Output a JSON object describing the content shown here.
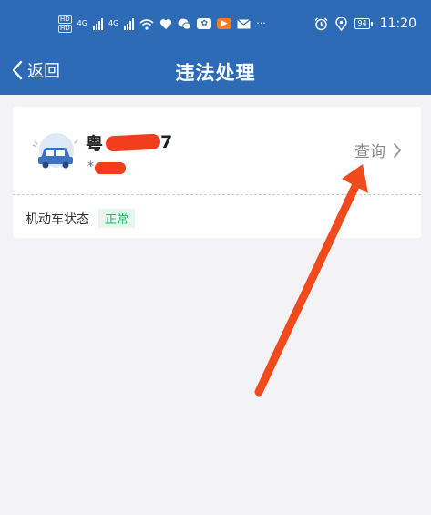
{
  "status_bar": {
    "hd_top": "HD",
    "hd_bottom": "HD",
    "net1": "4G",
    "net2": "4G",
    "battery": "94",
    "time": "11:20",
    "more": "···",
    "icons": [
      "signal-icon",
      "wifi-icon",
      "heart-icon",
      "wechat-icon",
      "baidu-icon",
      "video-icon",
      "mail-icon",
      "alarm-icon",
      "location-icon"
    ]
  },
  "nav": {
    "back_label": "返回",
    "title": "违法处理"
  },
  "vehicle": {
    "plate_prefix": "粤",
    "plate_suffix": "7",
    "owner_prefix": "*",
    "query_label": "查询",
    "status_label": "机动车状态",
    "status_value": "正常"
  },
  "colors": {
    "header_bg": "#2e6bb7",
    "status_green": "#1fb86a",
    "redaction_red": "#f23e1e",
    "arrow_red": "#f04a1d"
  }
}
